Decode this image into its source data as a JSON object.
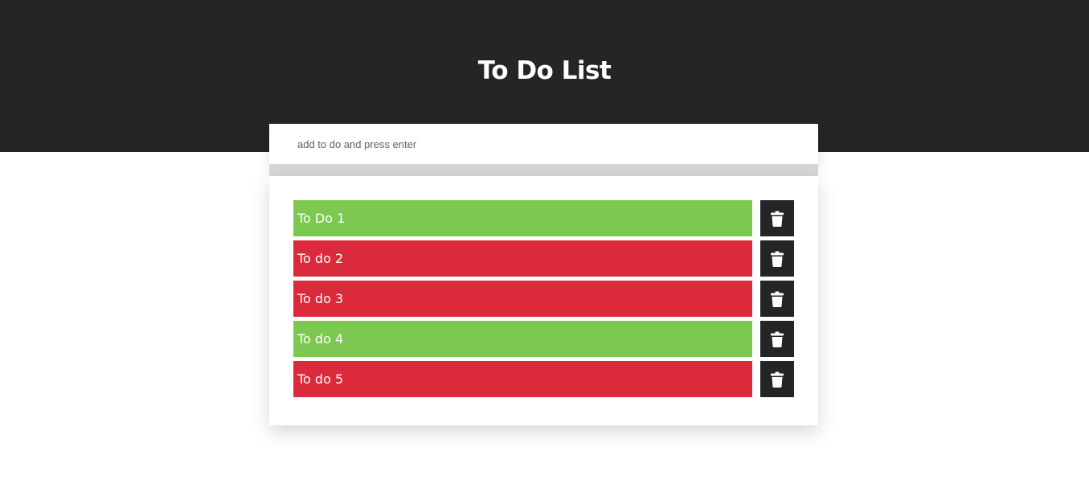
{
  "header": {
    "title": "To Do List"
  },
  "input": {
    "placeholder": "add to do and press enter",
    "value": ""
  },
  "colors": {
    "header_bg": "#242527",
    "done": "#7cc850",
    "pending": "#db2a3b",
    "delete_bg": "#242527"
  },
  "todos": [
    {
      "label": "To Do 1",
      "status": "done"
    },
    {
      "label": "To do 2",
      "status": "pending"
    },
    {
      "label": "To do 3",
      "status": "pending"
    },
    {
      "label": "To do 4",
      "status": "done"
    },
    {
      "label": "To do 5",
      "status": "pending"
    }
  ],
  "icons": {
    "delete": "trash-icon"
  }
}
